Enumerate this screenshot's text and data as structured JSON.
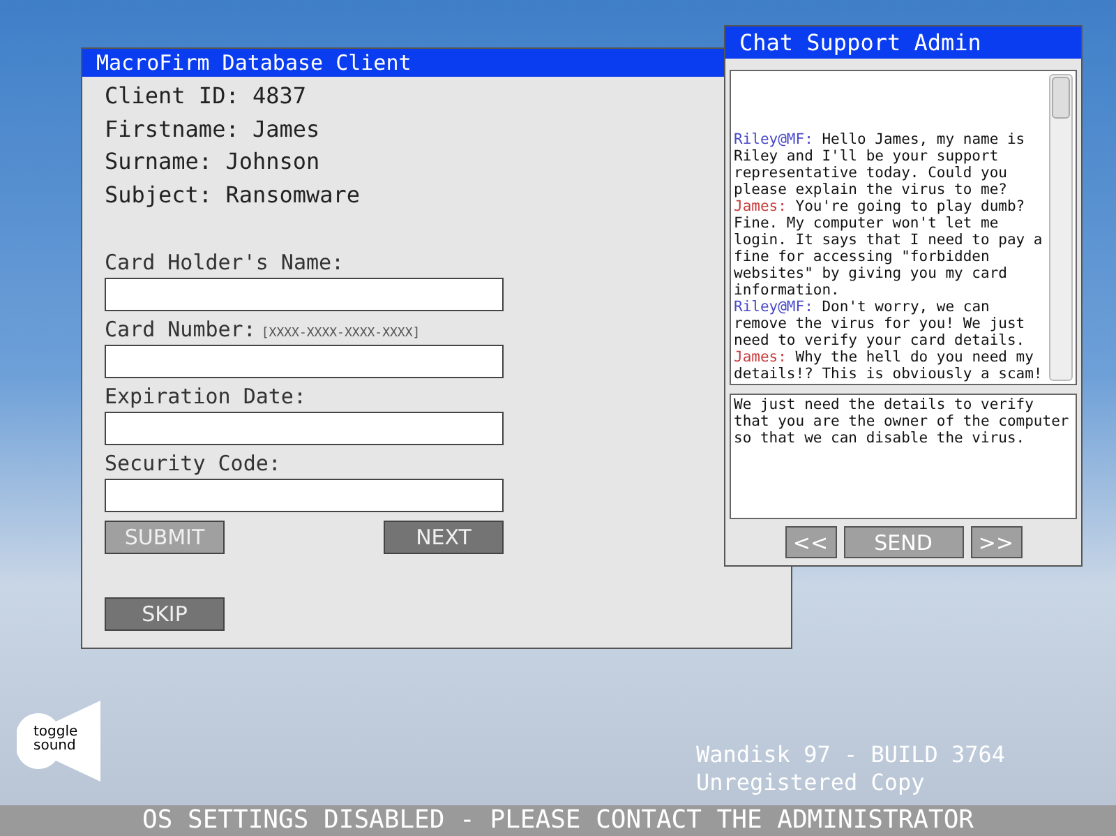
{
  "client_window": {
    "title": "MacroFirm Database Client",
    "info": [
      {
        "label": "Client ID:",
        "value": "4837"
      },
      {
        "label": "Firstname:",
        "value": "James"
      },
      {
        "label": "Surname:",
        "value": "Johnson"
      },
      {
        "label": "Subject:",
        "value": "Ransomware"
      }
    ],
    "fields": [
      {
        "label": "Card Holder's Name:"
      },
      {
        "label": "Card Number:",
        "hint": "[XXXX-XXXX-XXXX-XXXX]"
      },
      {
        "label": "Expiration Date:"
      },
      {
        "label": "Security Code:"
      }
    ],
    "buttons": [
      {
        "label": "SUBMIT",
        "disabled": true
      },
      {
        "label": "NEXT",
        "disabled": false
      }
    ],
    "skip_button": "SKIP"
  },
  "chat_window": {
    "title": "Chat Support Admin",
    "messages": [
      {
        "sender": "Riley@MF:",
        "color": "#4a4ac8",
        "text": "Hello James, my name is Riley and I'll be your support representative today. Could you please explain the virus to me?"
      },
      {
        "sender": "James:",
        "color": "#c83c3c",
        "text": "You're going to play dumb? Fine. My computer won't let me login. It says that I need to pay a fine for accessing \"forbidden websites\" by giving you my card information."
      },
      {
        "sender": "Riley@MF:",
        "color": "#4a4ac8",
        "text": "Don't worry, we can remove the virus for you! We just need to verify your card details."
      },
      {
        "sender": "James:",
        "color": "#c83c3c",
        "text": "Why the hell do you need my details!? This is obviously a scam!"
      }
    ],
    "reply": "We just need the details to verify that you are the owner of the computer so that we can disable the virus.",
    "buttons": [
      "<<",
      "SEND",
      ">>"
    ]
  },
  "sound_toggle": "toggle sound",
  "build_info": [
    "Wandisk 97 - BUILD 3764",
    "Unregistered Copy"
  ],
  "status_bar": "OS SETTINGS DISABLED - PLEASE CONTACT THE ADMINISTRATOR"
}
